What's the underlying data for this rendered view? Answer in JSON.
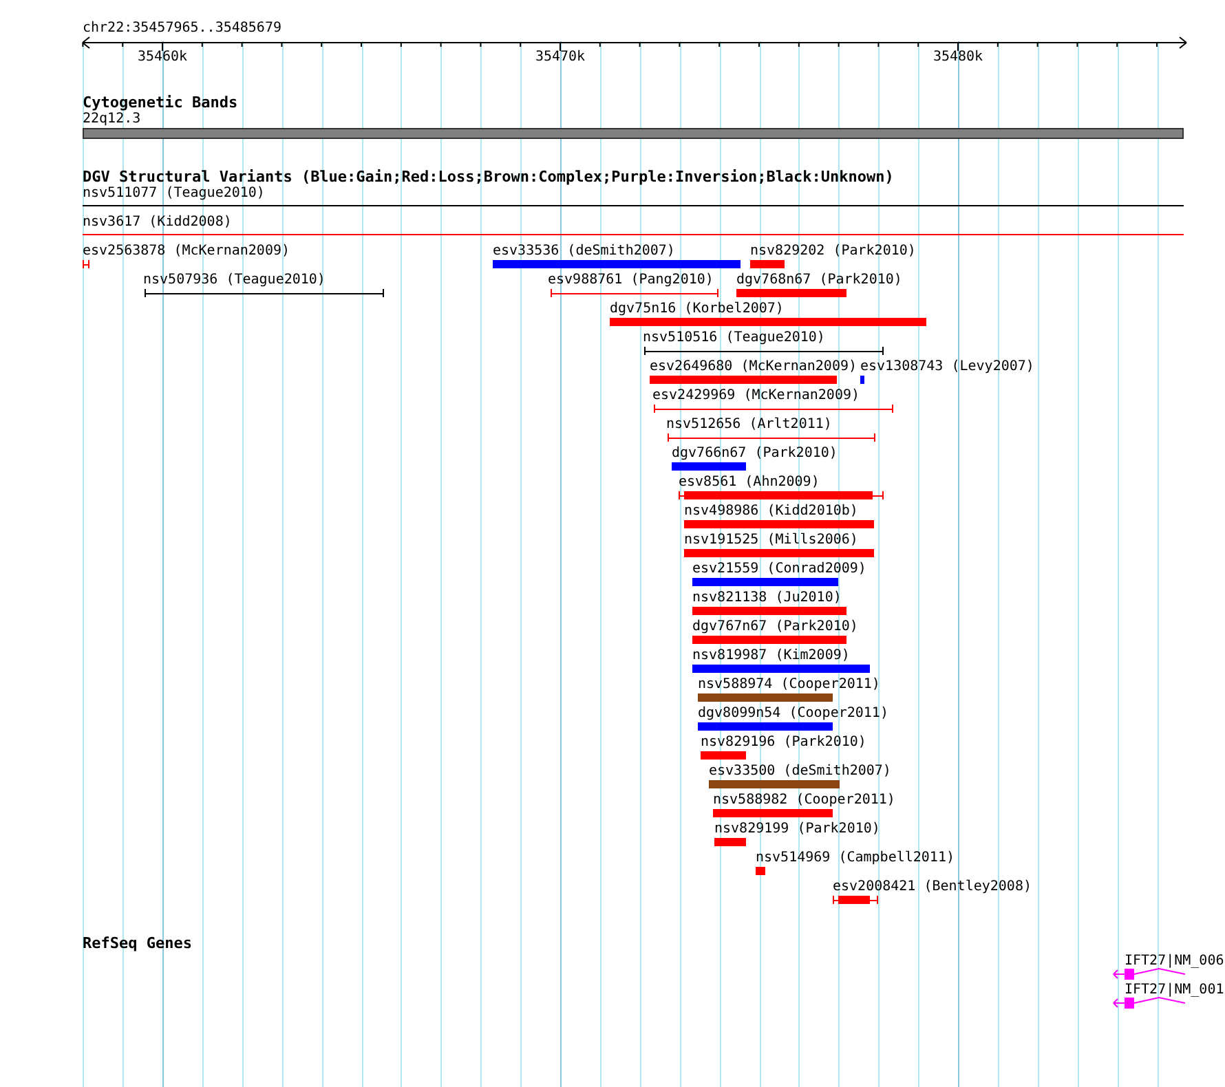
{
  "ruler": {
    "range": "chr22:35457965..35485679",
    "ticks": [
      "35460k",
      "35470k",
      "35480k"
    ]
  },
  "tracks": [
    {
      "kind": "cytoband",
      "title": "Cytogenetic Bands",
      "features": [
        {
          "label": "22q12.3"
        }
      ]
    },
    {
      "kind": "variants",
      "title": "DGV Structural Variants (Blue:Gain;Red:Loss;Brown:Complex;Purple:Inversion;Black:Unknown)",
      "features": [
        {
          "label": "nsv511077 (Teague2010)",
          "kind": "line",
          "color": "#000000"
        },
        {
          "label": "nsv3617 (Kidd2008)",
          "kind": "line",
          "color": "#ff0000"
        },
        {
          "label": "esv2563878 (McKernan2009)",
          "kind": "span",
          "color": "#ff0000"
        },
        {
          "label": "esv33536 (deSmith2007)",
          "kind": "bar",
          "color": "#0000ff"
        },
        {
          "label": "nsv829202 (Park2010)",
          "kind": "bar",
          "color": "#ff0000"
        },
        {
          "label": "nsv507936 (Teague2010)",
          "kind": "span",
          "color": "#000000"
        },
        {
          "label": "esv988761 (Pang2010)",
          "kind": "span",
          "color": "#ff0000"
        },
        {
          "label": "dgv768n67 (Park2010)",
          "kind": "bar",
          "color": "#ff0000"
        },
        {
          "label": "dgv75n16 (Korbel2007)",
          "kind": "bar",
          "color": "#ff0000"
        },
        {
          "label": "nsv510516 (Teague2010)",
          "kind": "span",
          "color": "#000000"
        },
        {
          "label": "esv2649680 (McKernan2009)",
          "kind": "bar",
          "color": "#ff0000"
        },
        {
          "label": "esv1308743 (Levy2007)",
          "kind": "bar",
          "color": "#0000ff"
        },
        {
          "label": "esv2429969 (McKernan2009)",
          "kind": "span",
          "color": "#ff0000"
        },
        {
          "label": "nsv512656 (Arlt2011)",
          "kind": "span",
          "color": "#ff0000"
        },
        {
          "label": "dgv766n67 (Park2010)",
          "kind": "bar",
          "color": "#0000ff"
        },
        {
          "label": "esv8561 (Ahn2009)",
          "kind": "capped",
          "color": "#ff0000"
        },
        {
          "label": "nsv498986 (Kidd2010b)",
          "kind": "bar",
          "color": "#ff0000"
        },
        {
          "label": "nsv191525 (Mills2006)",
          "kind": "bar",
          "color": "#ff0000"
        },
        {
          "label": "esv21559 (Conrad2009)",
          "kind": "bar",
          "color": "#0000ff"
        },
        {
          "label": "nsv821138 (Ju2010)",
          "kind": "bar",
          "color": "#ff0000"
        },
        {
          "label": "dgv767n67 (Park2010)",
          "kind": "bar",
          "color": "#ff0000"
        },
        {
          "label": "nsv819987 (Kim2009)",
          "kind": "bar",
          "color": "#0000ff"
        },
        {
          "label": "nsv588974 (Cooper2011)",
          "kind": "bar",
          "color": "#8b4513"
        },
        {
          "label": "dgv8099n54 (Cooper2011)",
          "kind": "bar",
          "color": "#0000ff"
        },
        {
          "label": "nsv829196 (Park2010)",
          "kind": "bar",
          "color": "#ff0000"
        },
        {
          "label": "esv33500 (deSmith2007)",
          "kind": "bar",
          "color": "#8b4513"
        },
        {
          "label": "nsv588982 (Cooper2011)",
          "kind": "bar",
          "color": "#ff0000"
        },
        {
          "label": "nsv829199 (Park2010)",
          "kind": "bar",
          "color": "#ff0000"
        },
        {
          "label": "nsv514969 (Campbell2011)",
          "kind": "bar",
          "color": "#ff0000"
        },
        {
          "label": "esv2008421 (Bentley2008)",
          "kind": "capped",
          "color": "#ff0000"
        }
      ]
    },
    {
      "kind": "genes",
      "title": "RefSeq Genes",
      "features": [
        {
          "label": "IFT27|NM_006"
        },
        {
          "label": "IFT27|NM_001"
        }
      ]
    }
  ]
}
